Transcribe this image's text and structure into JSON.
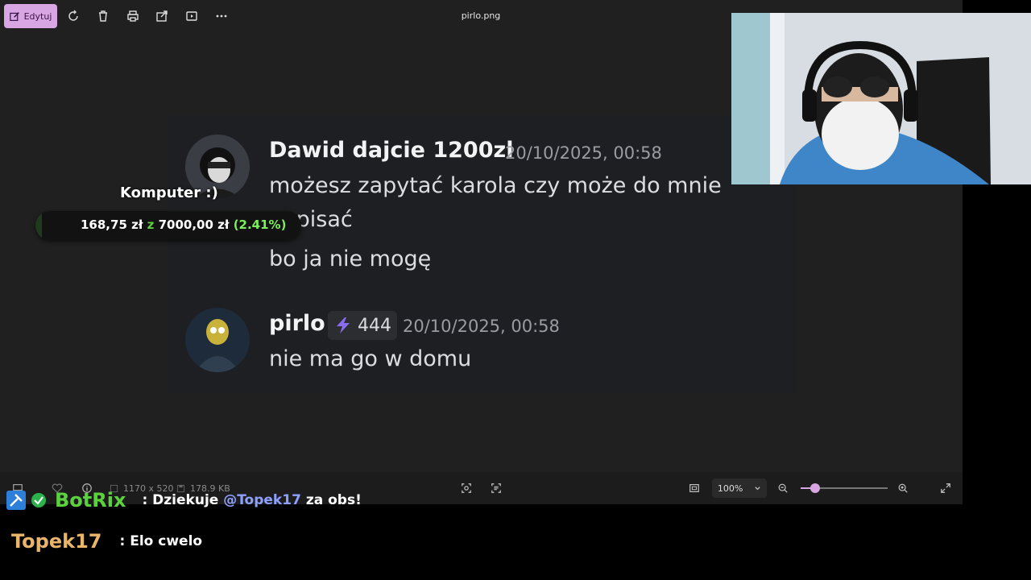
{
  "toolbar": {
    "edit_label": "Edytuj",
    "file_name": "pirlo.png",
    "icons": [
      "edit-icon",
      "rotate-icon",
      "trash-icon",
      "print-icon",
      "share-icon",
      "slideshow-icon",
      "more-icon"
    ]
  },
  "image": {
    "messages": [
      {
        "author": "Dawid dajcie 1200zl",
        "timestamp": "20/10/2025, 00:58",
        "lines": [
          "możesz zapytać karola czy może do mnie",
          "napisać",
          "bo ja nie mogę"
        ]
      },
      {
        "author": "pirlo",
        "badge": "444",
        "timestamp": "20/10/2025, 00:58",
        "lines": [
          "nie ma go w domu"
        ]
      }
    ]
  },
  "overlay": {
    "goal_title": "Komputer :)",
    "current": "168,75 zł",
    "separator": "z",
    "target": "7000,00 zł",
    "percent_text": "(2.41%)",
    "progress_fraction": 0.0241,
    "accent": "#5bd13d"
  },
  "statusbar": {
    "dimensions": "1170 x 520",
    "file_size": "178.9 KB",
    "zoom": "100%",
    "zoom_fraction": 0.17
  },
  "chat": [
    {
      "user": "BotRix",
      "user_color": "#5bd13d",
      "prefix": ": Dziekuje ",
      "mention": "@Topek17",
      "suffix": " za obs!"
    },
    {
      "user": "Topek17",
      "user_color": "#e8b56a",
      "message": ": Elo cwelo"
    }
  ],
  "colors": {
    "accent": "#d8a6e3",
    "viewer_bg": "#202020",
    "discord_bg": "#1e1f22"
  }
}
